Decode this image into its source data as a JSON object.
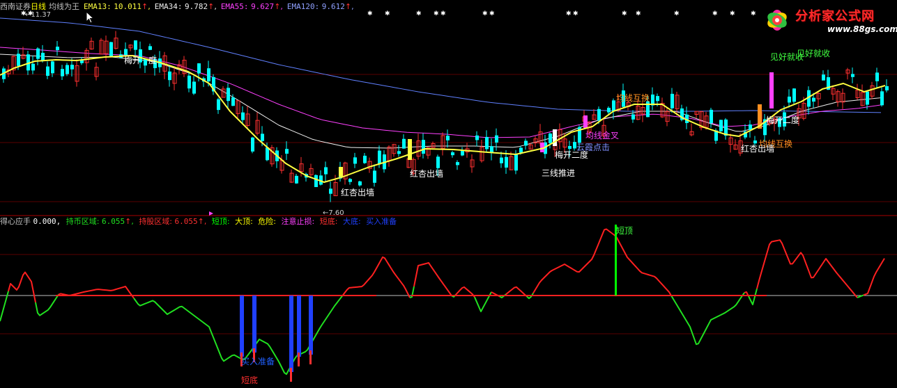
{
  "upper_header": {
    "broker": "西南证券",
    "period": "日线",
    "indicator_name": "均线为王",
    "ema13_label": "EMA13:",
    "ema13_value": "10.011",
    "ema34_label": "EMA34:",
    "ema34_value": "9.782",
    "ema55_label": "EMA55:",
    "ema55_value": "9.627",
    "ema120_label": "EMA120:",
    "ema120_value": "9.612",
    "arrow": "↑",
    "comma": ","
  },
  "lower_header": {
    "name": "得心应手",
    "name_value": "0.000,",
    "hold_label": "持币区域:",
    "hold_value": "6.055",
    "hold_stock_label": "持股区域:",
    "hold_stock_value": "6.055",
    "short_top": "短顶:",
    "big_top": "大顶:",
    "danger": "危险:",
    "caution": "注意止损:",
    "short_bottom": "短底:",
    "big_bottom": "大底:",
    "buy_ready": "买入准备",
    "arrow": "↑",
    "comma": ","
  },
  "price_labels": {
    "high": "11.37",
    "low": "7.60"
  },
  "annotations": {
    "mei_kai_1": "梅开",
    "mei_kai_2": "度",
    "hong_xing_1": "红杏出墙",
    "hong_xing_2": "红杏出墙",
    "hong_xing_3": "红杏出墙",
    "san_xian": "三线推进",
    "mei_kai_er_1": "梅开二度",
    "mei_kai_er_2": "梅开二度",
    "yun_xia": "云霞点击",
    "jin_cha": "均线金叉",
    "jun_xian_hu_huan_1": "均线互换",
    "jun_xian_hu_huan_2": "均线互换",
    "jian_hao_1": "见好就收",
    "jian_hao_2": "见好就收",
    "duan_ding": "短顶",
    "mai_ru": "买入准备",
    "duan_di": "短底"
  },
  "logo": {
    "title": "分析家公式网",
    "url": "www.88gs.com"
  },
  "colors": {
    "up": "#ff3030",
    "down": "#00ffff",
    "ema13": "#ffff40",
    "ema34": "#f0f0f0",
    "ema55": "#ff40ff",
    "ema120": "#6080ff",
    "osc_up": "#ff2020",
    "osc_down": "#20e020",
    "bar_blue": "#2040ff",
    "bar_green": "#00ff00"
  }
}
